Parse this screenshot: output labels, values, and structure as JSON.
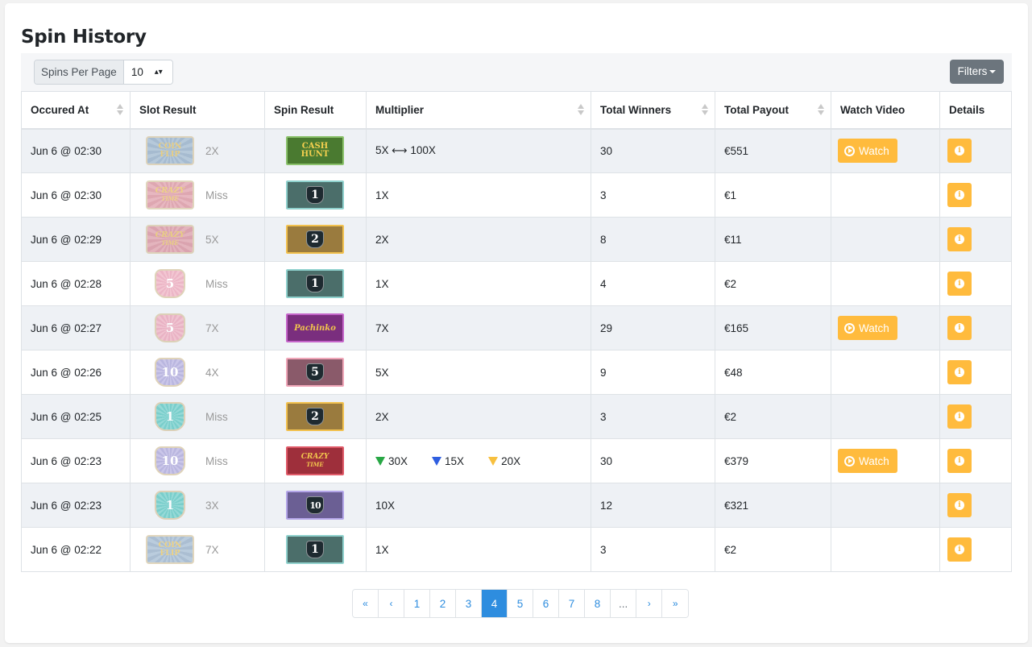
{
  "page": {
    "title": "Spin History"
  },
  "toolbar": {
    "per_page_label": "Spins Per Page",
    "per_page_value": "10",
    "filters_label": "Filters"
  },
  "table": {
    "headers": [
      "Occured At",
      "Slot Result",
      "Spin Result",
      "Multiplier",
      "Total Winners",
      "Total Payout",
      "Watch Video",
      "Details"
    ],
    "watch_label": "Watch",
    "rows": [
      {
        "occurred_at": "Jun 6 @ 02:30",
        "slot": "coin-flip",
        "slot_text": "COIN FLIP",
        "slot_result": "2X",
        "spin": "cash-hunt",
        "spin_text": "CASH HUNT",
        "multiplier": "5X ⟷ 100X",
        "winners": "30",
        "payout": "€551",
        "watch": true
      },
      {
        "occurred_at": "Jun 6 @ 02:30",
        "slot": "crazy-time",
        "slot_text": "CRAZY TIME",
        "slot_result": "Miss",
        "spin": "1",
        "spin_text": "1",
        "multiplier": "1X",
        "winners": "3",
        "payout": "€1",
        "watch": false
      },
      {
        "occurred_at": "Jun 6 @ 02:29",
        "slot": "crazy-time",
        "slot_text": "CRAZY TIME",
        "slot_result": "5X",
        "spin": "2",
        "spin_text": "2",
        "multiplier": "2X",
        "winners": "8",
        "payout": "€11",
        "watch": false
      },
      {
        "occurred_at": "Jun 6 @ 02:28",
        "slot": "5",
        "slot_text": "5",
        "slot_result": "Miss",
        "spin": "1",
        "spin_text": "1",
        "multiplier": "1X",
        "winners": "4",
        "payout": "€2",
        "watch": false
      },
      {
        "occurred_at": "Jun 6 @ 02:27",
        "slot": "5",
        "slot_text": "5",
        "slot_result": "7X",
        "spin": "pachinko",
        "spin_text": "Pachinko",
        "multiplier": "7X",
        "winners": "29",
        "payout": "€165",
        "watch": true
      },
      {
        "occurred_at": "Jun 6 @ 02:26",
        "slot": "10",
        "slot_text": "10",
        "slot_result": "4X",
        "spin": "5",
        "spin_text": "5",
        "multiplier": "5X",
        "winners": "9",
        "payout": "€48",
        "watch": false
      },
      {
        "occurred_at": "Jun 6 @ 02:25",
        "slot": "1",
        "slot_text": "1",
        "slot_result": "Miss",
        "spin": "2",
        "spin_text": "2",
        "multiplier": "2X",
        "winners": "3",
        "payout": "€2",
        "watch": false
      },
      {
        "occurred_at": "Jun 6 @ 02:23",
        "slot": "10",
        "slot_text": "10",
        "slot_result": "Miss",
        "spin": "crazy-time",
        "spin_text": "CRAZY TIME",
        "multiplier": "",
        "bonus": [
          {
            "color": "#28a745",
            "value": "30X"
          },
          {
            "color": "#2f5ee0",
            "value": "15X"
          },
          {
            "color": "#f7c03f",
            "value": "20X"
          }
        ],
        "winners": "30",
        "payout": "€379",
        "watch": true
      },
      {
        "occurred_at": "Jun 6 @ 02:23",
        "slot": "1",
        "slot_text": "1",
        "slot_result": "3X",
        "spin": "10",
        "spin_text": "10",
        "multiplier": "10X",
        "winners": "12",
        "payout": "€321",
        "watch": false
      },
      {
        "occurred_at": "Jun 6 @ 02:22",
        "slot": "coin-flip",
        "slot_text": "COIN FLIP",
        "slot_result": "7X",
        "spin": "1",
        "spin_text": "1",
        "multiplier": "1X",
        "winners": "3",
        "payout": "€2",
        "watch": false
      }
    ]
  },
  "pagination": {
    "items": [
      "«",
      "‹",
      "1",
      "2",
      "3",
      "4",
      "5",
      "6",
      "7",
      "8",
      "...",
      "›",
      "»"
    ],
    "active": "4"
  },
  "colors": {
    "accent": "#ffbb3d",
    "primary": "#2e8ddf",
    "filters": "#6c757d"
  }
}
